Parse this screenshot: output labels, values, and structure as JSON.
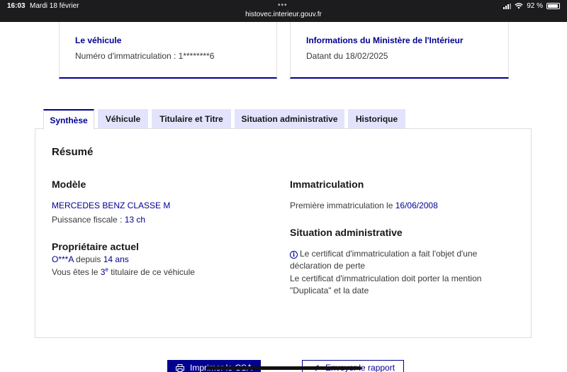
{
  "status_bar": {
    "time": "16:03",
    "date": "Mardi 18 février",
    "url": "histovec.interieur.gouv.fr",
    "battery": "92 %"
  },
  "cards": {
    "vehicle": {
      "title": "Le véhicule",
      "text": "Numéro d'immatriculation : 1********6"
    },
    "ministry": {
      "title": "Informations du Ministère de l'Intérieur",
      "text": "Datant du 18/02/2025"
    }
  },
  "tabs": [
    {
      "label": "Synthèse",
      "active": true
    },
    {
      "label": "Véhicule",
      "active": false
    },
    {
      "label": "Titulaire et Titre",
      "active": false
    },
    {
      "label": "Situation administrative",
      "active": false
    },
    {
      "label": "Historique",
      "active": false
    }
  ],
  "summary": {
    "heading": "Résumé",
    "modele": {
      "heading": "Modèle",
      "name": "MERCEDES BENZ CLASSE M",
      "power_label": "Puissance fiscale : ",
      "power_value": "13 ch"
    },
    "proprietaire": {
      "heading": "Propriétaire actuel",
      "owner": "O***A",
      "since_label": " depuis ",
      "since_value": "14 ans",
      "rank_prefix": "Vous êtes le ",
      "rank_number": "3",
      "rank_suffix_sup": "e",
      "rank_suffix": " titulaire de ce véhicule"
    },
    "immatriculation": {
      "heading": "Immatriculation",
      "first_label": "Première immatriculation le ",
      "first_date": "16/06/2008"
    },
    "situation": {
      "heading": "Situation administrative",
      "line1": "Le certificat d'immatriculation a fait l'objet d'une",
      "line2": "déclaration de perte",
      "line3": "Le certificat d'immatriculation doit porter la mention",
      "line4": "\"Duplicata\" et la date"
    }
  },
  "buttons": {
    "print": "Imprimer le CSA",
    "send": "Envoyer le rapport"
  },
  "colors": {
    "accent": "#000091",
    "tab_inactive_bg": "#e3e3fd"
  }
}
